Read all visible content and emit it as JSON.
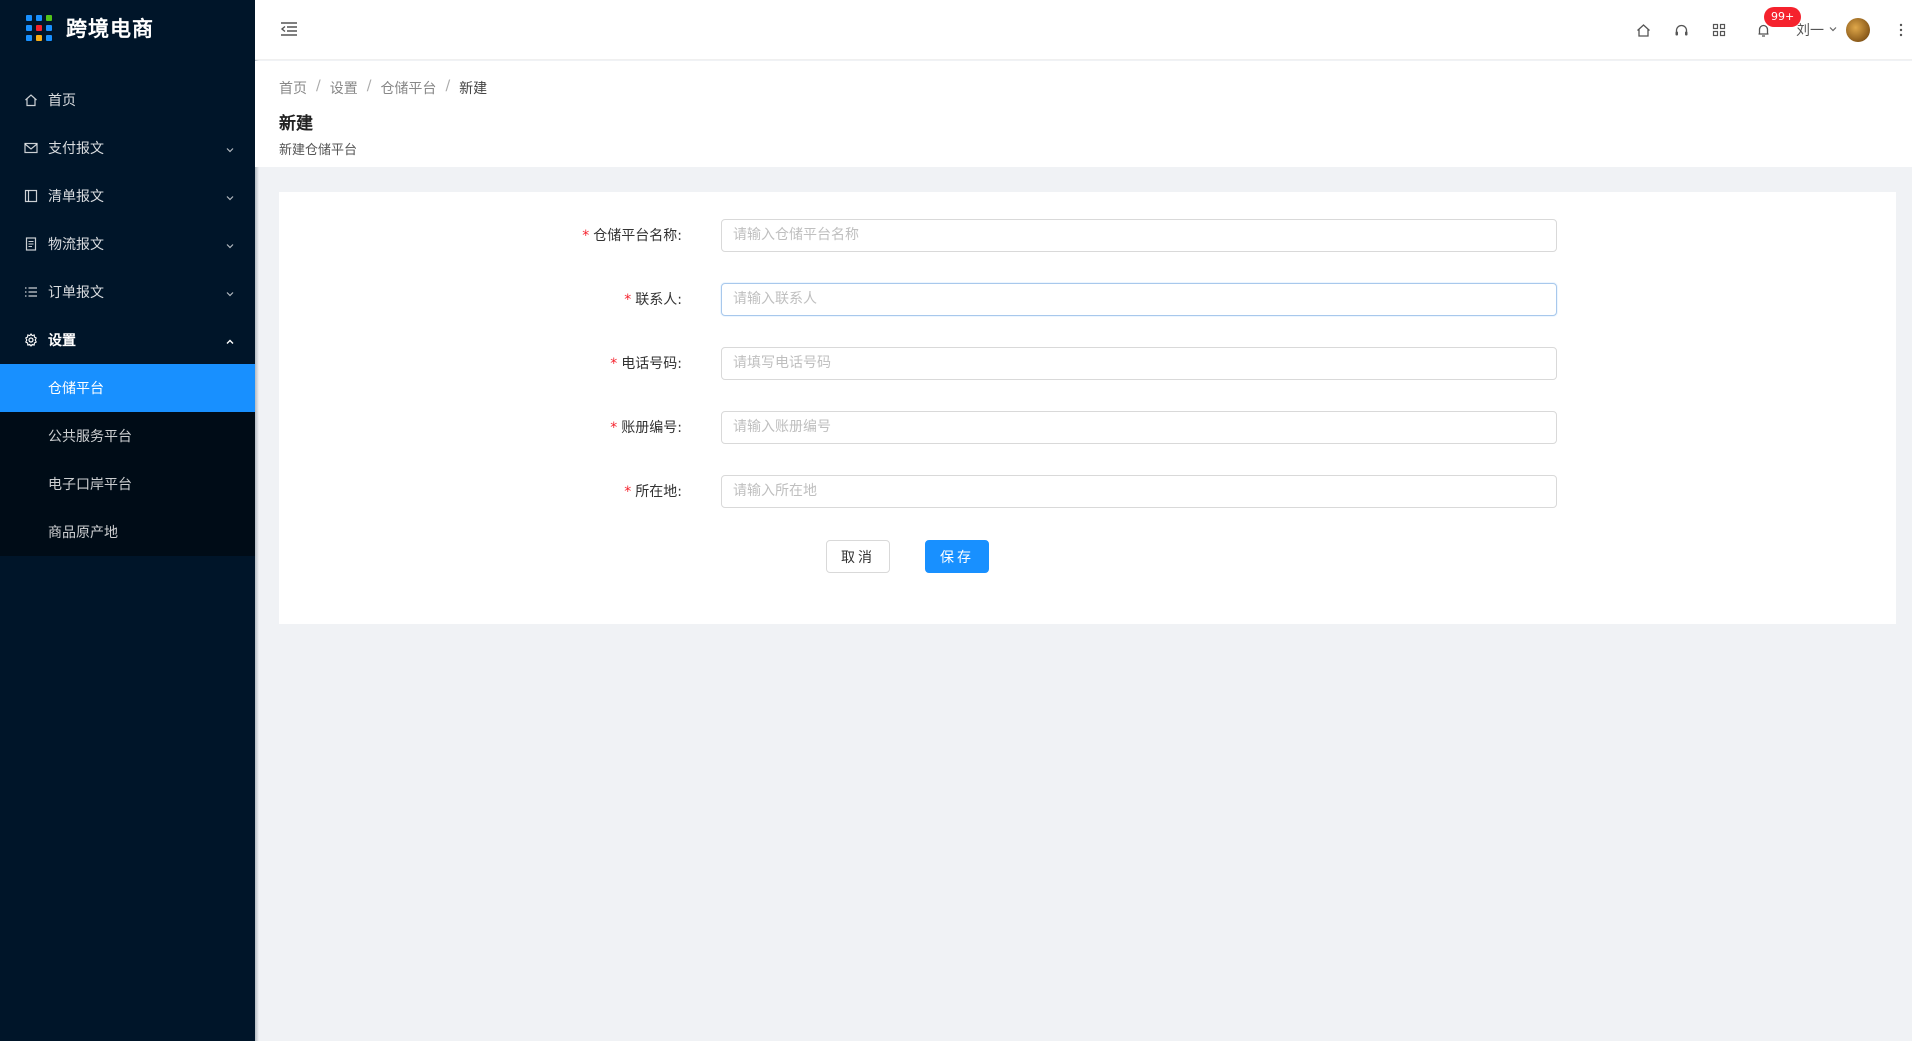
{
  "app": {
    "title": "跨境电商",
    "logo_colors": [
      "#1890ff",
      "#1890ff",
      "#52c41a",
      "#1890ff",
      "#f5222d",
      "#1890ff",
      "#1890ff",
      "#faad14",
      "#1890ff"
    ]
  },
  "sidebar": {
    "items": [
      {
        "label": "首页",
        "icon": "home-icon",
        "has_children": false
      },
      {
        "label": "支付报文",
        "icon": "mail-icon",
        "has_children": true
      },
      {
        "label": "清单报文",
        "icon": "layout-icon",
        "has_children": true
      },
      {
        "label": "物流报文",
        "icon": "file-icon",
        "has_children": true
      },
      {
        "label": "订单报文",
        "icon": "list-icon",
        "has_children": true
      },
      {
        "label": "设置",
        "icon": "gear-icon",
        "has_children": true,
        "open": true
      }
    ],
    "settings_children": [
      {
        "label": "仓储平台",
        "active": true
      },
      {
        "label": "公共服务平台"
      },
      {
        "label": "电子口岸平台"
      },
      {
        "label": "商品原产地"
      }
    ]
  },
  "header": {
    "notification_badge": "99+",
    "user_name": "刘一"
  },
  "breadcrumb": [
    "首页",
    "设置",
    "仓储平台",
    "新建"
  ],
  "page": {
    "title": "新建",
    "subtitle": "新建仓储平台"
  },
  "form": {
    "fields": [
      {
        "label": "仓储平台名称:",
        "placeholder": "请输入仓储平台名称",
        "value": "",
        "required": "*"
      },
      {
        "label": "联系人:",
        "placeholder": "请输入联系人",
        "value": "",
        "required": "*"
      },
      {
        "label": "电话号码:",
        "placeholder": "请填写电话号码",
        "value": "",
        "required": "*"
      },
      {
        "label": "账册编号:",
        "placeholder": "请输入账册编号",
        "value": "",
        "required": "*"
      },
      {
        "label": "所在地:",
        "placeholder": "请输入所在地",
        "value": "",
        "required": "*"
      }
    ],
    "cancel_label": "取消",
    "save_label": "保存"
  },
  "colors": {
    "sidebar_bg": "#001529",
    "submenu_bg": "#000c17",
    "primary": "#1890ff",
    "required": "#f5222d",
    "page_bg": "#f0f2f5"
  }
}
